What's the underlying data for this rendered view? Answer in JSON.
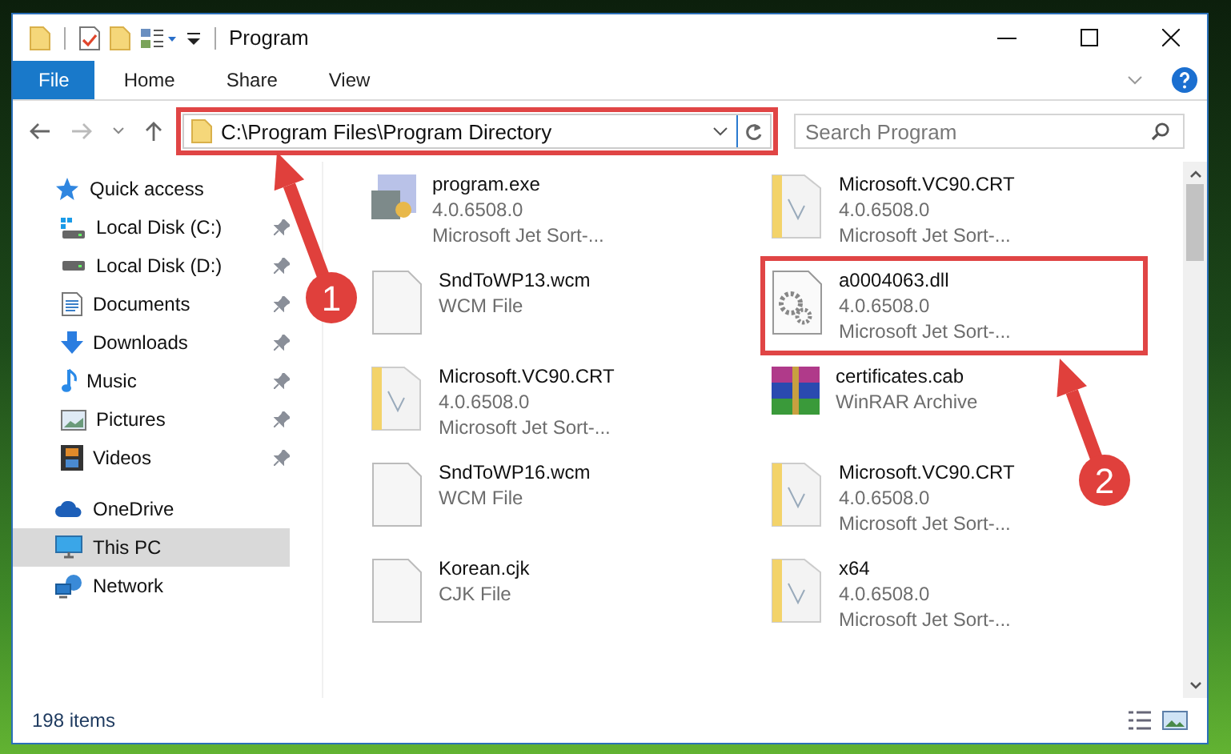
{
  "window": {
    "title": "Program"
  },
  "ribbon_tabs": [
    {
      "label": "File",
      "selected": true
    },
    {
      "label": "Home",
      "selected": false
    },
    {
      "label": "Share",
      "selected": false
    },
    {
      "label": "View",
      "selected": false
    }
  ],
  "address": {
    "path": "C:\\Program Files\\Program Directory",
    "highlighted": true
  },
  "search": {
    "placeholder": "Search Program"
  },
  "sidebar": {
    "items": [
      {
        "label": "Quick access",
        "kind": "star",
        "selected": false,
        "children": [
          {
            "label": "Local Disk (C:)",
            "kind": "system-drive",
            "pinned": true,
            "selected": false
          },
          {
            "label": "Local Disk (D:)",
            "kind": "drive",
            "pinned": true,
            "selected": false
          },
          {
            "label": "Documents",
            "kind": "documents",
            "pinned": true,
            "selected": false
          },
          {
            "label": "Downloads",
            "kind": "downloads",
            "pinned": true,
            "selected": false
          },
          {
            "label": "Music",
            "kind": "music",
            "pinned": true,
            "selected": false
          },
          {
            "label": "Pictures",
            "kind": "pictures",
            "pinned": true,
            "selected": false
          },
          {
            "label": "Videos",
            "kind": "videos",
            "pinned": true,
            "selected": false
          }
        ]
      },
      {
        "label": "OneDrive",
        "kind": "cloud",
        "selected": false
      },
      {
        "label": "This PC",
        "kind": "pc",
        "selected": true
      },
      {
        "label": "Network",
        "kind": "network",
        "selected": false
      }
    ]
  },
  "files": [
    {
      "name": "program.exe",
      "details": [
        "4.0.6508.0",
        "Microsoft Jet Sort-..."
      ],
      "kind": "exe",
      "highlighted": false
    },
    {
      "name": "Microsoft.VC90.CRT",
      "details": [
        "4.0.6508.0",
        "Microsoft Jet Sort-..."
      ],
      "kind": "folder",
      "highlighted": false
    },
    {
      "name": "SndToWP13.wcm",
      "details": [
        "WCM File"
      ],
      "kind": "file",
      "highlighted": false
    },
    {
      "name": "a0004063.dll",
      "details": [
        "4.0.6508.0",
        "Microsoft Jet Sort-..."
      ],
      "kind": "dll",
      "highlighted": true
    },
    {
      "name": "Microsoft.VC90.CRT",
      "details": [
        "4.0.6508.0",
        "Microsoft Jet Sort-..."
      ],
      "kind": "folder",
      "highlighted": false
    },
    {
      "name": "certificates.cab",
      "details": [
        "WinRAR Archive"
      ],
      "kind": "archive",
      "highlighted": false
    },
    {
      "name": "SndToWP16.wcm",
      "details": [
        "WCM File"
      ],
      "kind": "file",
      "highlighted": false
    },
    {
      "name": "Microsoft.VC90.CRT",
      "details": [
        "4.0.6508.0",
        "Microsoft Jet Sort-..."
      ],
      "kind": "folder",
      "highlighted": false
    },
    {
      "name": "Korean.cjk",
      "details": [
        "CJK File"
      ],
      "kind": "file",
      "highlighted": false
    },
    {
      "name": "x64",
      "details": [
        "4.0.6508.0",
        "Microsoft Jet Sort-..."
      ],
      "kind": "folder",
      "highlighted": false
    }
  ],
  "status_bar": {
    "item_count": "198 items"
  },
  "annotations": [
    {
      "number": "1"
    },
    {
      "number": "2"
    }
  ]
}
